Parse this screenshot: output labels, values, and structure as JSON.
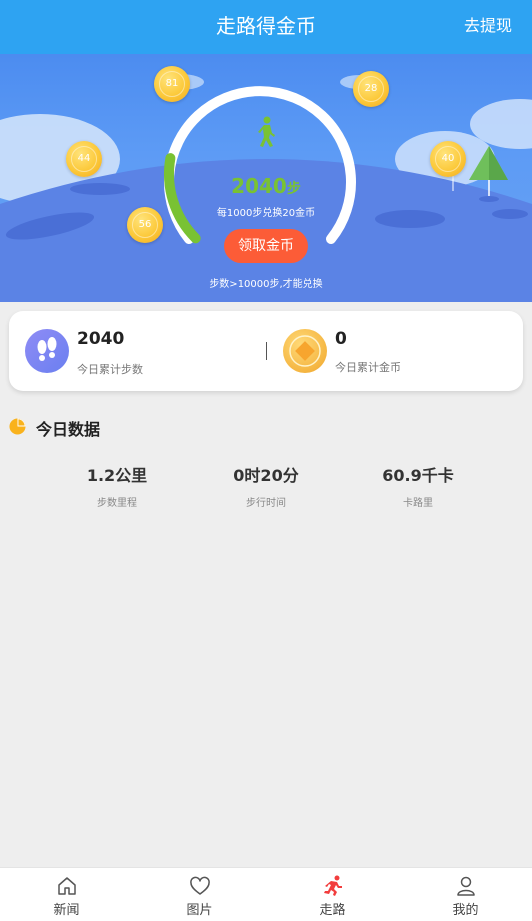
{
  "header": {
    "title": "走路得金币",
    "withdraw_label": "去提现"
  },
  "hero": {
    "coins": [
      "81",
      "28",
      "44",
      "40",
      "56"
    ],
    "steps_value": "2040",
    "steps_unit": "步",
    "exchange_rate": "每1000步兑换20金币",
    "claim_button": "领取金币",
    "hint": "步数>10000步,才能兑换",
    "progress_fraction": 0.204,
    "colors": {
      "progress": "#79c233",
      "track": "#ffffff",
      "claim_button": "#fc5c37",
      "header": "#2ea3f2"
    }
  },
  "stats": {
    "steps": {
      "value": "2040",
      "label": "今日累计步数",
      "icon": "footprints-icon"
    },
    "coins": {
      "value": "0",
      "label": "今日累计金币",
      "icon": "coin-icon"
    }
  },
  "today": {
    "title": "今日数据",
    "metrics": [
      {
        "value": "1.2公里",
        "label": "步数里程"
      },
      {
        "value": "0时20分",
        "label": "步行时间"
      },
      {
        "value": "60.9千卡",
        "label": "卡路里"
      }
    ]
  },
  "nav": {
    "items": [
      {
        "label": "新闻",
        "icon": "home-icon"
      },
      {
        "label": "图片",
        "icon": "heart-icon"
      },
      {
        "label": "走路",
        "icon": "running-icon",
        "active": true
      },
      {
        "label": "我的",
        "icon": "user-icon"
      }
    ]
  }
}
